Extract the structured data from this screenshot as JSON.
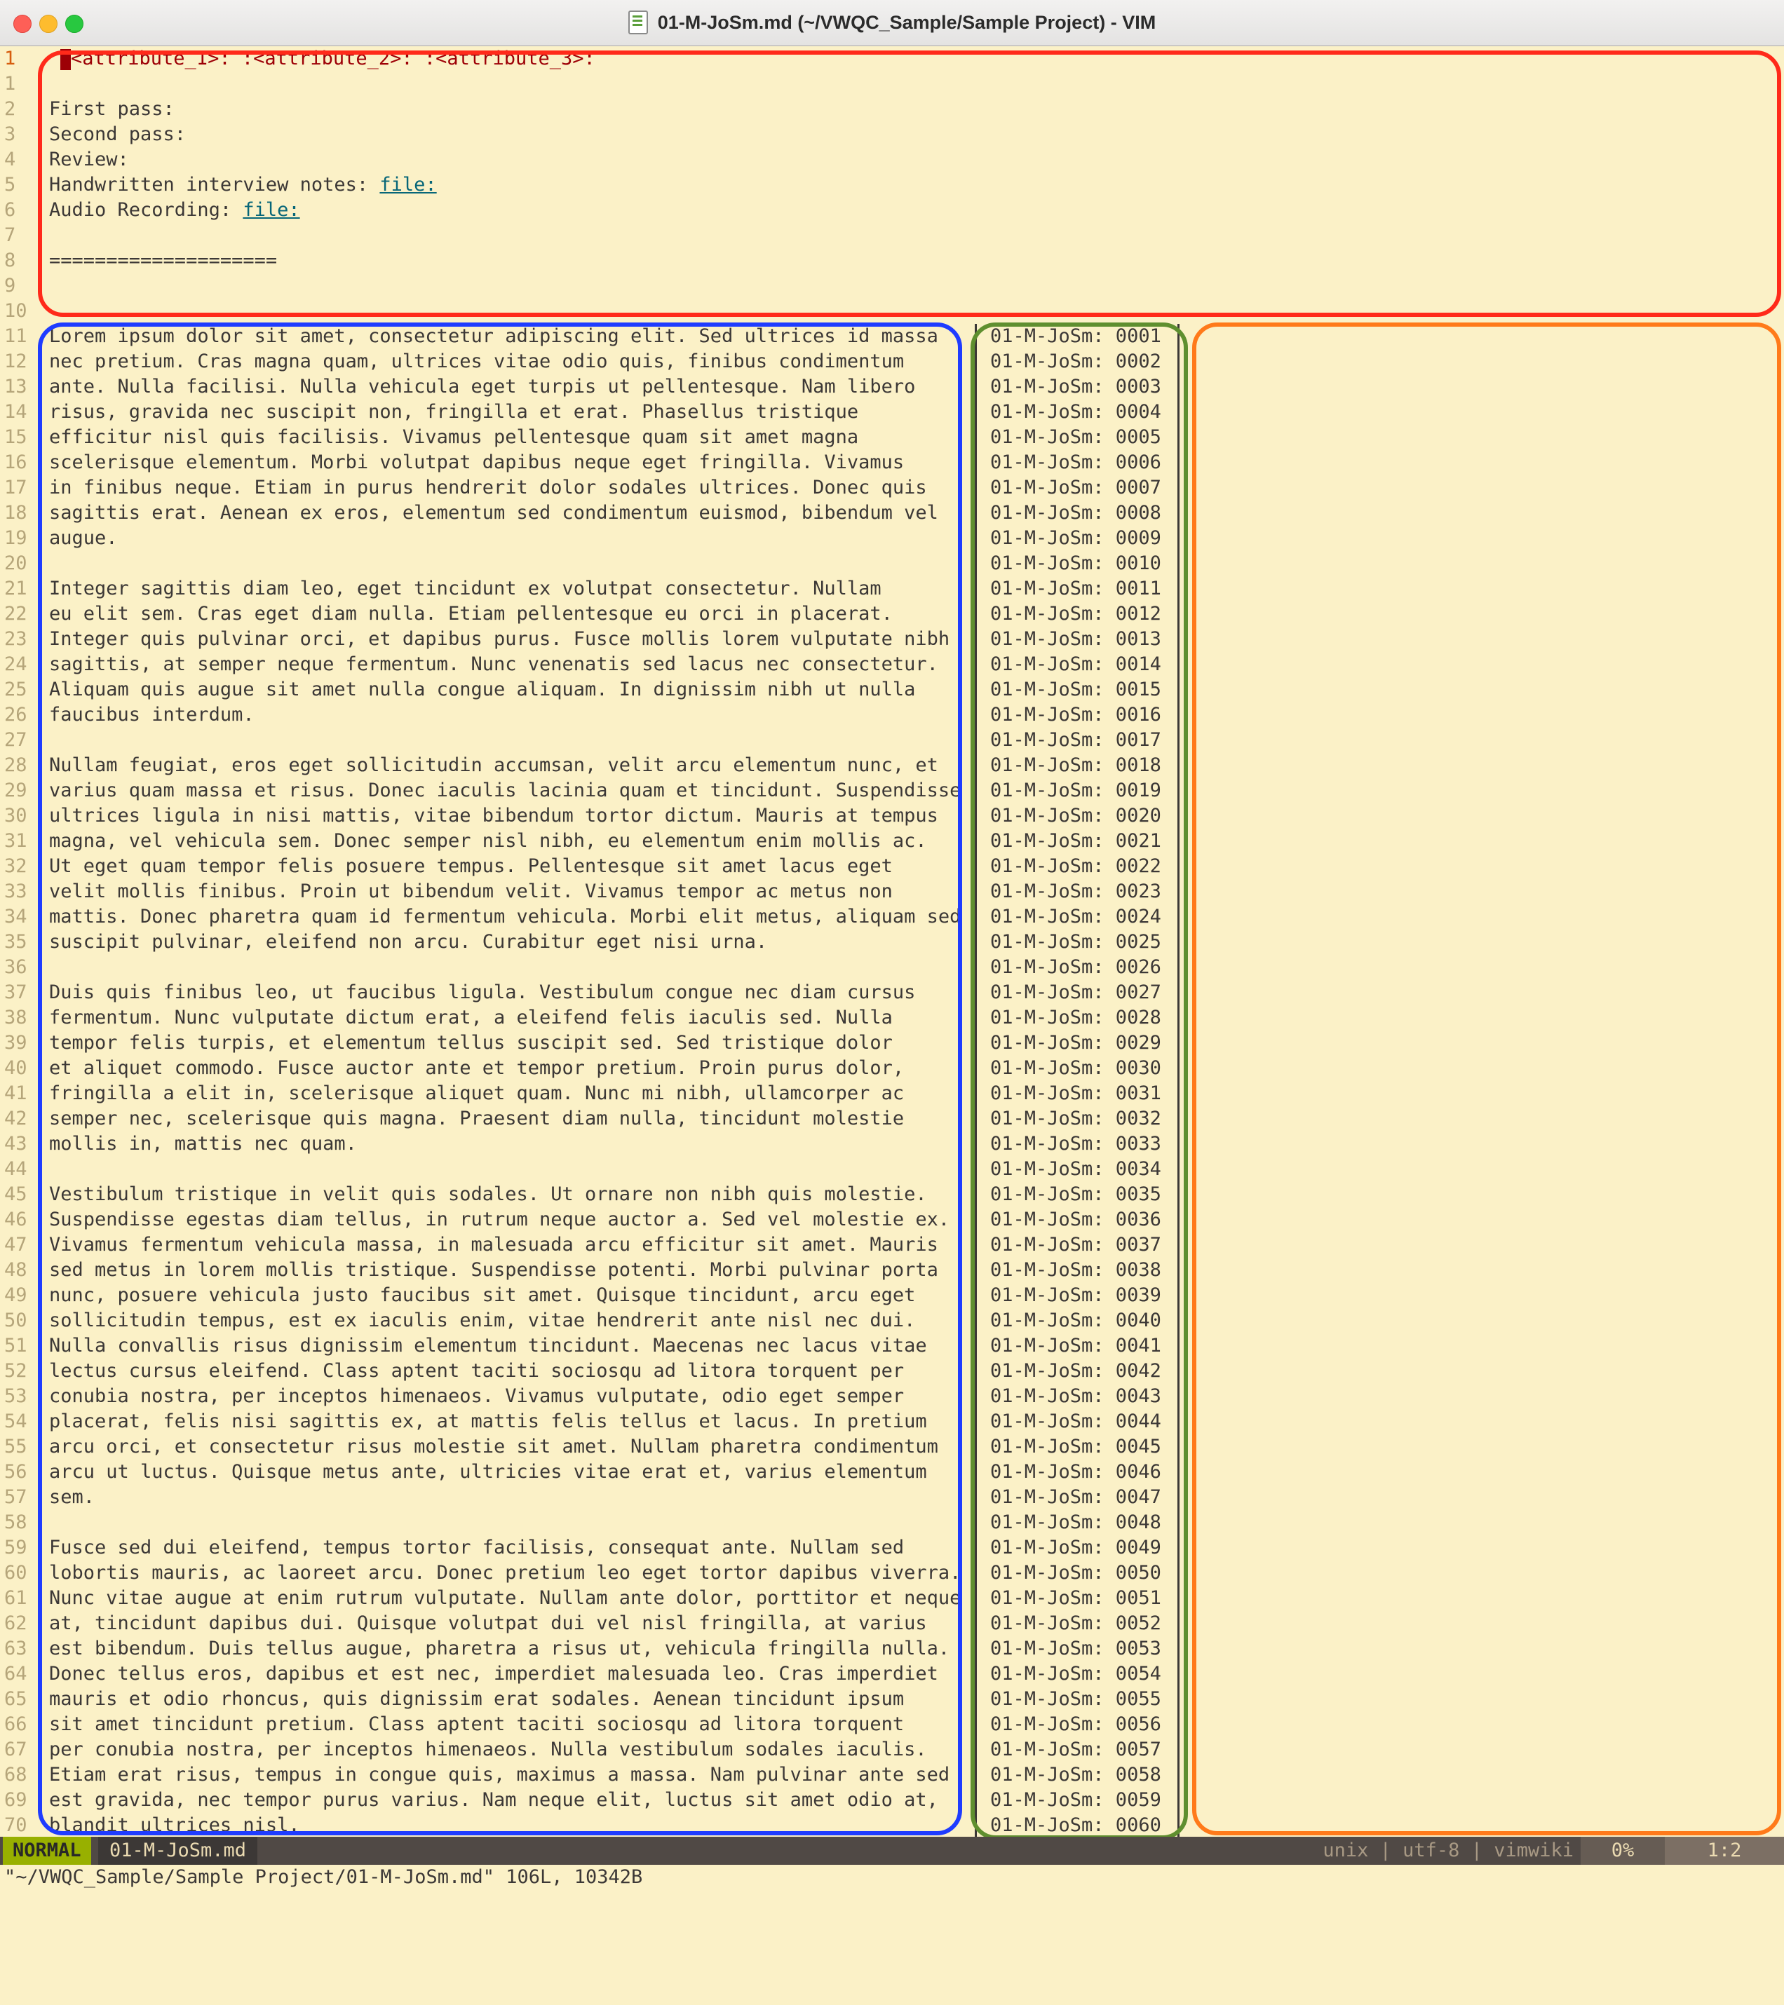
{
  "window": {
    "title": "01-M-JoSm.md (~/VWQC_Sample/Sample Project) - VIM"
  },
  "header_lines": [
    {
      "num": "1",
      "text": "",
      "cur": true
    },
    {
      "num": "1",
      "text": ""
    },
    {
      "num": "2",
      "text": "First pass:"
    },
    {
      "num": "3",
      "text": "Second pass:"
    },
    {
      "num": "4",
      "text": "Review:"
    },
    {
      "num": "5",
      "text": "Handwritten interview notes: ",
      "link": "file:"
    },
    {
      "num": "6",
      "text": "Audio Recording: ",
      "link": "file:"
    },
    {
      "num": "7",
      "text": ""
    },
    {
      "num": "8",
      "text": "===================="
    },
    {
      "num": "9",
      "text": ""
    },
    {
      "num": "10",
      "text": ""
    }
  ],
  "attribute_line": "<attribute_1>: :<attribute_2>: :<attribute_3>:",
  "body_lines": [
    [
      "11",
      "Lorem ipsum dolor sit amet, consectetur adipiscing elit. Sed ultrices id massa",
      "01-M-JoSm: 0001"
    ],
    [
      "12",
      "nec pretium. Cras magna quam, ultrices vitae odio quis, finibus condimentum",
      "01-M-JoSm: 0002"
    ],
    [
      "13",
      "ante. Nulla facilisi. Nulla vehicula eget turpis ut pellentesque. Nam libero",
      "01-M-JoSm: 0003"
    ],
    [
      "14",
      "risus, gravida nec suscipit non, fringilla et erat. Phasellus tristique",
      "01-M-JoSm: 0004"
    ],
    [
      "15",
      "efficitur nisl quis facilisis. Vivamus pellentesque quam sit amet magna",
      "01-M-JoSm: 0005"
    ],
    [
      "16",
      "scelerisque elementum. Morbi volutpat dapibus neque eget fringilla. Vivamus",
      "01-M-JoSm: 0006"
    ],
    [
      "17",
      "in finibus neque. Etiam in purus hendrerit dolor sodales ultrices. Donec quis",
      "01-M-JoSm: 0007"
    ],
    [
      "18",
      "sagittis erat. Aenean ex eros, elementum sed condimentum euismod, bibendum vel",
      "01-M-JoSm: 0008"
    ],
    [
      "19",
      "augue.",
      "01-M-JoSm: 0009"
    ],
    [
      "20",
      "",
      "01-M-JoSm: 0010"
    ],
    [
      "21",
      "Integer sagittis diam leo, eget tincidunt ex volutpat consectetur. Nullam",
      "01-M-JoSm: 0011"
    ],
    [
      "22",
      "eu elit sem. Cras eget diam nulla. Etiam pellentesque eu orci in placerat.",
      "01-M-JoSm: 0012"
    ],
    [
      "23",
      "Integer quis pulvinar orci, et dapibus purus. Fusce mollis lorem vulputate nibh",
      "01-M-JoSm: 0013"
    ],
    [
      "24",
      "sagittis, at semper neque fermentum. Nunc venenatis sed lacus nec consectetur.",
      "01-M-JoSm: 0014"
    ],
    [
      "25",
      "Aliquam quis augue sit amet nulla congue aliquam. In dignissim nibh ut nulla",
      "01-M-JoSm: 0015"
    ],
    [
      "26",
      "faucibus interdum.",
      "01-M-JoSm: 0016"
    ],
    [
      "27",
      "",
      "01-M-JoSm: 0017"
    ],
    [
      "28",
      "Nullam feugiat, eros eget sollicitudin accumsan, velit arcu elementum nunc, et",
      "01-M-JoSm: 0018"
    ],
    [
      "29",
      "varius quam massa et risus. Donec iaculis lacinia quam et tincidunt. Suspendisse",
      "01-M-JoSm: 0019"
    ],
    [
      "30",
      "ultrices ligula in nisi mattis, vitae bibendum tortor dictum. Mauris at tempus",
      "01-M-JoSm: 0020"
    ],
    [
      "31",
      "magna, vel vehicula sem. Donec semper nisl nibh, eu elementum enim mollis ac.",
      "01-M-JoSm: 0021"
    ],
    [
      "32",
      "Ut eget quam tempor felis posuere tempus. Pellentesque sit amet lacus eget",
      "01-M-JoSm: 0022"
    ],
    [
      "33",
      "velit mollis finibus. Proin ut bibendum velit. Vivamus tempor ac metus non",
      "01-M-JoSm: 0023"
    ],
    [
      "34",
      "mattis. Donec pharetra quam id fermentum vehicula. Morbi elit metus, aliquam sed",
      "01-M-JoSm: 0024"
    ],
    [
      "35",
      "suscipit pulvinar, eleifend non arcu. Curabitur eget nisi urna.",
      "01-M-JoSm: 0025"
    ],
    [
      "36",
      "",
      "01-M-JoSm: 0026"
    ],
    [
      "37",
      "Duis quis finibus leo, ut faucibus ligula. Vestibulum congue nec diam cursus",
      "01-M-JoSm: 0027"
    ],
    [
      "38",
      "fermentum. Nunc vulputate dictum erat, a eleifend felis iaculis sed. Nulla",
      "01-M-JoSm: 0028"
    ],
    [
      "39",
      "tempor felis turpis, et elementum tellus suscipit sed. Sed tristique dolor",
      "01-M-JoSm: 0029"
    ],
    [
      "40",
      "et aliquet commodo. Fusce auctor ante et tempor pretium. Proin purus dolor,",
      "01-M-JoSm: 0030"
    ],
    [
      "41",
      "fringilla a elit in, scelerisque aliquet quam. Nunc mi nibh, ullamcorper ac",
      "01-M-JoSm: 0031"
    ],
    [
      "42",
      "semper nec, scelerisque quis magna. Praesent diam nulla, tincidunt molestie",
      "01-M-JoSm: 0032"
    ],
    [
      "43",
      "mollis in, mattis nec quam.",
      "01-M-JoSm: 0033"
    ],
    [
      "44",
      "",
      "01-M-JoSm: 0034"
    ],
    [
      "45",
      "Vestibulum tristique in velit quis sodales. Ut ornare non nibh quis molestie.",
      "01-M-JoSm: 0035"
    ],
    [
      "46",
      "Suspendisse egestas diam tellus, in rutrum neque auctor a. Sed vel molestie ex.",
      "01-M-JoSm: 0036"
    ],
    [
      "47",
      "Vivamus fermentum vehicula massa, in malesuada arcu efficitur sit amet. Mauris",
      "01-M-JoSm: 0037"
    ],
    [
      "48",
      "sed metus in lorem mollis tristique. Suspendisse potenti. Morbi pulvinar porta",
      "01-M-JoSm: 0038"
    ],
    [
      "49",
      "nunc, posuere vehicula justo faucibus sit amet. Quisque tincidunt, arcu eget",
      "01-M-JoSm: 0039"
    ],
    [
      "50",
      "sollicitudin tempus, est ex iaculis enim, vitae hendrerit ante nisl nec dui.",
      "01-M-JoSm: 0040"
    ],
    [
      "51",
      "Nulla convallis risus dignissim elementum tincidunt. Maecenas nec lacus vitae",
      "01-M-JoSm: 0041"
    ],
    [
      "52",
      "lectus cursus eleifend. Class aptent taciti sociosqu ad litora torquent per",
      "01-M-JoSm: 0042"
    ],
    [
      "53",
      "conubia nostra, per inceptos himenaeos. Vivamus vulputate, odio eget semper",
      "01-M-JoSm: 0043"
    ],
    [
      "54",
      "placerat, felis nisi sagittis ex, at mattis felis tellus et lacus. In pretium",
      "01-M-JoSm: 0044"
    ],
    [
      "55",
      "arcu orci, et consectetur risus molestie sit amet. Nullam pharetra condimentum",
      "01-M-JoSm: 0045"
    ],
    [
      "56",
      "arcu ut luctus. Quisque metus ante, ultricies vitae erat et, varius elementum",
      "01-M-JoSm: 0046"
    ],
    [
      "57",
      "sem.",
      "01-M-JoSm: 0047"
    ],
    [
      "58",
      "",
      "01-M-JoSm: 0048"
    ],
    [
      "59",
      "Fusce sed dui eleifend, tempus tortor facilisis, consequat ante. Nullam sed",
      "01-M-JoSm: 0049"
    ],
    [
      "60",
      "lobortis mauris, ac laoreet arcu. Donec pretium leo eget tortor dapibus viverra.",
      "01-M-JoSm: 0050"
    ],
    [
      "61",
      "Nunc vitae augue at enim rutrum vulputate. Nullam ante dolor, porttitor et neque",
      "01-M-JoSm: 0051"
    ],
    [
      "62",
      "at, tincidunt dapibus dui. Quisque volutpat dui vel nisl fringilla, at varius",
      "01-M-JoSm: 0052"
    ],
    [
      "63",
      "est bibendum. Duis tellus augue, pharetra a risus ut, vehicula fringilla nulla.",
      "01-M-JoSm: 0053"
    ],
    [
      "64",
      "Donec tellus eros, dapibus et est nec, imperdiet malesuada leo. Cras imperdiet",
      "01-M-JoSm: 0054"
    ],
    [
      "65",
      "mauris et odio rhoncus, quis dignissim erat sodales. Aenean tincidunt ipsum",
      "01-M-JoSm: 0055"
    ],
    [
      "66",
      "sit amet tincidunt pretium. Class aptent taciti sociosqu ad litora torquent",
      "01-M-JoSm: 0056"
    ],
    [
      "67",
      "per conubia nostra, per inceptos himenaeos. Nulla vestibulum sodales iaculis.",
      "01-M-JoSm: 0057"
    ],
    [
      "68",
      "Etiam erat risus, tempus in congue quis, maximus a massa. Nam pulvinar ante sed",
      "01-M-JoSm: 0058"
    ],
    [
      "69",
      "est gravida, nec tempor purus varius. Nam neque elit, luctus sit amet odio at,",
      "01-M-JoSm: 0059"
    ],
    [
      "70",
      "blandit ultrices nisl.",
      "01-M-JoSm: 0060"
    ]
  ],
  "statusline": {
    "mode": "NORMAL",
    "filename": "01-M-JoSm.md",
    "info": "unix | utf-8 | vimwiki",
    "percent": "0%",
    "position": "1:2"
  },
  "cmdline": "\"~/VWQC_Sample/Sample Project/01-M-JoSm.md\" 106L, 10342B",
  "colors": {
    "box_red": "#ff2a1a",
    "box_blue": "#1f3cff",
    "box_green": "#5f8f2f",
    "box_orange": "#ff7a1a",
    "mode_bg": "#98b000",
    "background": "#fbf1c7"
  },
  "icons": {
    "title": "text-document-icon"
  }
}
